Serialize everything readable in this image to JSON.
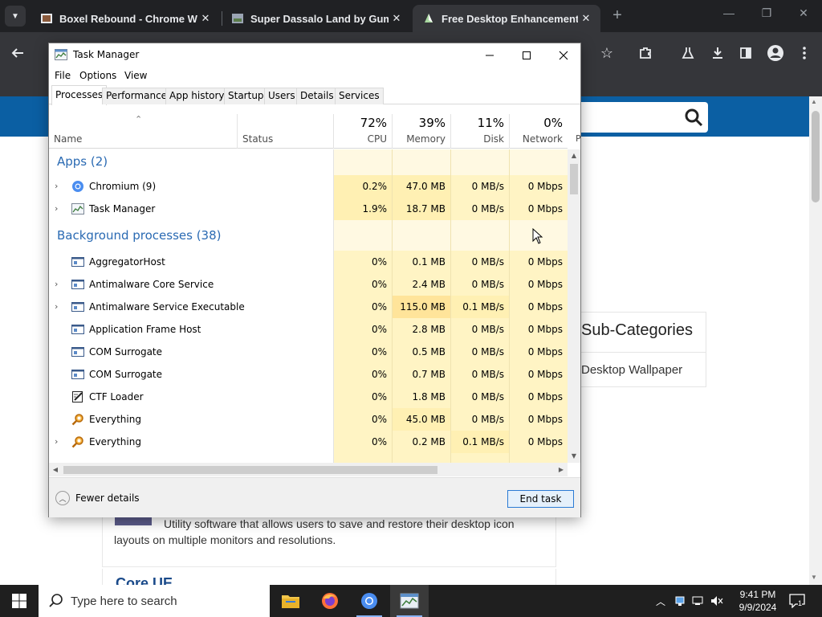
{
  "browser": {
    "tabs": [
      {
        "title": "Boxel Rebound - Chrome Web",
        "close": "✕",
        "active": false
      },
      {
        "title": "Super Dassalo Land by Gumpy",
        "close": "✕",
        "active": false
      },
      {
        "title": "Free Desktop Enhancement So",
        "close": "✕",
        "active": true
      }
    ],
    "new_tab": "+"
  },
  "webpage": {
    "subcategories_title": "Sub-Categories",
    "subcategory_item": "Desktop Wallpaper",
    "card_description": "Utility software that allows users to save and restore their desktop icon layouts on multiple monitors and resolutions.",
    "card2_title": "Core UE"
  },
  "task_manager": {
    "title": "Task Manager",
    "menu": [
      "File",
      "Options",
      "View"
    ],
    "tabs": [
      "Processes",
      "Performance",
      "App history",
      "Startup",
      "Users",
      "Details",
      "Services"
    ],
    "active_tab": "Processes",
    "columns": {
      "name": "Name",
      "status": "Status",
      "cpu": {
        "pct": "72%",
        "label": "CPU"
      },
      "memory": {
        "pct": "39%",
        "label": "Memory"
      },
      "disk": {
        "pct": "11%",
        "label": "Disk"
      },
      "network": {
        "pct": "0%",
        "label": "Network"
      },
      "next_partial": "P"
    },
    "groups": {
      "apps": "Apps (2)",
      "background": "Background processes (38)"
    },
    "apps": [
      {
        "name": "Chromium (9)",
        "icon": "chromium-icon",
        "expandable": true,
        "cpu": "0.2%",
        "memory": "47.0 MB",
        "disk": "0 MB/s",
        "network": "0 Mbps"
      },
      {
        "name": "Task Manager",
        "icon": "task-manager-icon",
        "expandable": true,
        "cpu": "1.9%",
        "memory": "18.7 MB",
        "disk": "0 MB/s",
        "network": "0 Mbps"
      }
    ],
    "background": [
      {
        "name": "AggregatorHost",
        "icon": "service-icon",
        "expandable": false,
        "cpu": "0%",
        "memory": "0.1 MB",
        "disk": "0 MB/s",
        "network": "0 Mbps"
      },
      {
        "name": "Antimalware Core Service",
        "icon": "service-icon",
        "expandable": true,
        "cpu": "0%",
        "memory": "2.4 MB",
        "disk": "0 MB/s",
        "network": "0 Mbps"
      },
      {
        "name": "Antimalware Service Executable",
        "icon": "service-icon",
        "expandable": true,
        "cpu": "0%",
        "memory": "115.0 MB",
        "disk": "0.1 MB/s",
        "network": "0 Mbps"
      },
      {
        "name": "Application Frame Host",
        "icon": "service-icon",
        "expandable": false,
        "cpu": "0%",
        "memory": "2.8 MB",
        "disk": "0 MB/s",
        "network": "0 Mbps"
      },
      {
        "name": "COM Surrogate",
        "icon": "service-icon",
        "expandable": false,
        "cpu": "0%",
        "memory": "0.5 MB",
        "disk": "0 MB/s",
        "network": "0 Mbps"
      },
      {
        "name": "COM Surrogate",
        "icon": "service-icon",
        "expandable": false,
        "cpu": "0%",
        "memory": "0.7 MB",
        "disk": "0 MB/s",
        "network": "0 Mbps"
      },
      {
        "name": "CTF Loader",
        "icon": "ctf-loader-icon",
        "expandable": false,
        "cpu": "0%",
        "memory": "1.8 MB",
        "disk": "0 MB/s",
        "network": "0 Mbps"
      },
      {
        "name": "Everything",
        "icon": "everything-search-icon",
        "expandable": false,
        "cpu": "0%",
        "memory": "45.0 MB",
        "disk": "0 MB/s",
        "network": "0 Mbps"
      },
      {
        "name": "Everything",
        "icon": "everything-search-icon",
        "expandable": true,
        "cpu": "0%",
        "memory": "0.2 MB",
        "disk": "0.1 MB/s",
        "network": "0 Mbps"
      }
    ],
    "footer": {
      "fewer_details": "Fewer details",
      "end_task": "End task"
    }
  },
  "taskbar": {
    "search_placeholder": "Type here to search",
    "time": "9:41 PM",
    "date": "9/9/2024",
    "notifications_count": "1"
  },
  "colors": {
    "heat_light": "#fff4c4",
    "heat_medium": "#ffe49a",
    "accent_blue": "#2a6ab3",
    "site_header": "#0b5fa3"
  }
}
